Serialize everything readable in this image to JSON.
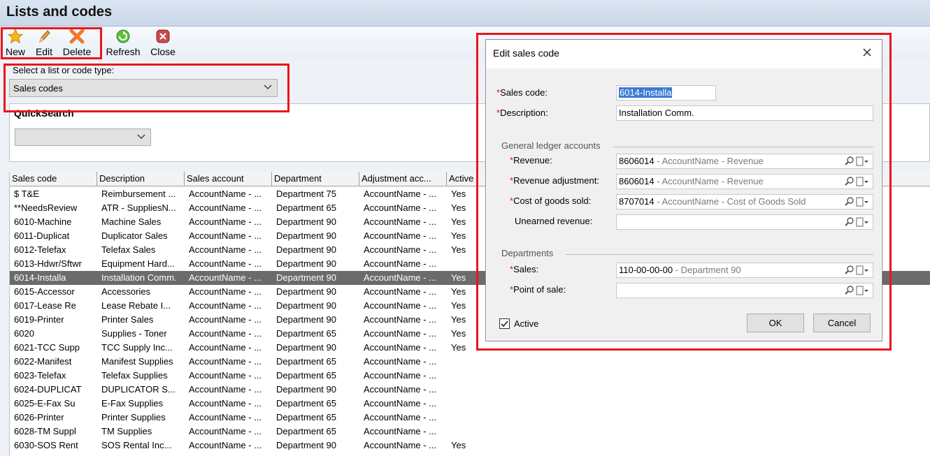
{
  "window": {
    "title": "Lists and codes"
  },
  "toolbar": {
    "new_label": "New",
    "edit_label": "Edit",
    "delete_label": "Delete",
    "refresh_label": "Refresh",
    "close_label": "Close"
  },
  "selector": {
    "label": "Select a list or code type:",
    "value": "Sales codes"
  },
  "quicksearch": {
    "label": "QuickSearch",
    "value": ""
  },
  "grid": {
    "columns": [
      "Sales code",
      "Description",
      "Sales account",
      "Department",
      "Adjustment acc...",
      "Active"
    ],
    "selected_row": 7,
    "rows": [
      [
        "$ T&E",
        "Reimbursement ...",
        "AccountName - ...",
        "Department 75",
        "AccountName - ...",
        "Yes"
      ],
      [
        "**NeedsReview",
        "ATR - SuppliesN...",
        "AccountName - ...",
        "Department 65",
        "AccountName - ...",
        "Yes"
      ],
      [
        "6010-Machine",
        "Machine Sales",
        "AccountName - ...",
        "Department 90",
        "AccountName - ...",
        "Yes"
      ],
      [
        "6011-Duplicat",
        "Duplicator Sales",
        "AccountName - ...",
        "Department 90",
        "AccountName - ...",
        "Yes"
      ],
      [
        "6012-Telefax",
        "Telefax Sales",
        "AccountName - ...",
        "Department 90",
        "AccountName - ...",
        "Yes"
      ],
      [
        "6013-Hdwr/Sftwr",
        "Equipment Hard...",
        "AccountName - ...",
        "Department 90",
        "AccountName - ...",
        ""
      ],
      [
        "6014-Installa",
        "Installation Comm.",
        "AccountName - ...",
        "Department 90",
        "AccountName - ...",
        "Yes"
      ],
      [
        "6015-Accessor",
        "Accessories",
        "AccountName - ...",
        "Department 90",
        "AccountName - ...",
        "Yes"
      ],
      [
        "6017-Lease Re",
        "Lease Rebate I...",
        "AccountName - ...",
        "Department 90",
        "AccountName - ...",
        "Yes"
      ],
      [
        "6019-Printer",
        "Printer Sales",
        "AccountName - ...",
        "Department 90",
        "AccountName - ...",
        "Yes"
      ],
      [
        "6020",
        "Supplies - Toner",
        "AccountName - ...",
        "Department 65",
        "AccountName - ...",
        "Yes"
      ],
      [
        "6021-TCC Supp",
        "TCC Supply Inc...",
        "AccountName - ...",
        "Department 90",
        "AccountName - ...",
        "Yes"
      ],
      [
        "6022-Manifest",
        "Manifest Supplies",
        "AccountName - ...",
        "Department 65",
        "AccountName - ...",
        ""
      ],
      [
        "6023-Telefax",
        "Telefax Supplies",
        "AccountName - ...",
        "Department 65",
        "AccountName - ...",
        ""
      ],
      [
        "6024-DUPLICAT",
        "DUPLICATOR S...",
        "AccountName - ...",
        "Department 90",
        "AccountName - ...",
        ""
      ],
      [
        "6025-E-Fax Su",
        "E-Fax Supplies",
        "AccountName - ...",
        "Department 65",
        "AccountName - ...",
        ""
      ],
      [
        "6026-Printer",
        "Printer Supplies",
        "AccountName - ...",
        "Department 65",
        "AccountName - ...",
        ""
      ],
      [
        "6028-TM Suppl",
        "TM Supplies",
        "AccountName - ...",
        "Department 65",
        "AccountName - ...",
        ""
      ],
      [
        "6030-SOS Rent",
        "SOS Rental Inc...",
        "AccountName - ...",
        "Department 90",
        "AccountName - ...",
        "Yes"
      ]
    ]
  },
  "dialog": {
    "title": "Edit sales code",
    "sales_code_label": "Sales code:",
    "sales_code_value": "6014-Installa",
    "description_label": "Description:",
    "description_value": "Installation Comm.",
    "gl_group_label": "General ledger accounts",
    "revenue_label": "Revenue:",
    "revenue_code": "8606014",
    "revenue_name": " - AccountName - Revenue",
    "revenue_adj_label": "Revenue adjustment:",
    "revenue_adj_code": "8606014",
    "revenue_adj_name": " - AccountName - Revenue",
    "cogs_label": "Cost of goods sold:",
    "cogs_code": "8707014",
    "cogs_name": " - AccountName - Cost of Goods Sold",
    "unearned_label": "Unearned revenue:",
    "dept_group_label": "Departments",
    "sales_dept_label": "Sales:",
    "sales_dept_code": "110-00-00-00",
    "sales_dept_name": " - Department 90",
    "pos_label": "Point of sale:",
    "active_label": "Active",
    "active_checked": true,
    "ok_label": "OK",
    "cancel_label": "Cancel"
  },
  "colors": {
    "required_marker": "#d7191c",
    "highlight_box": "#e8161d",
    "selected_row": "#6b6b6b"
  }
}
